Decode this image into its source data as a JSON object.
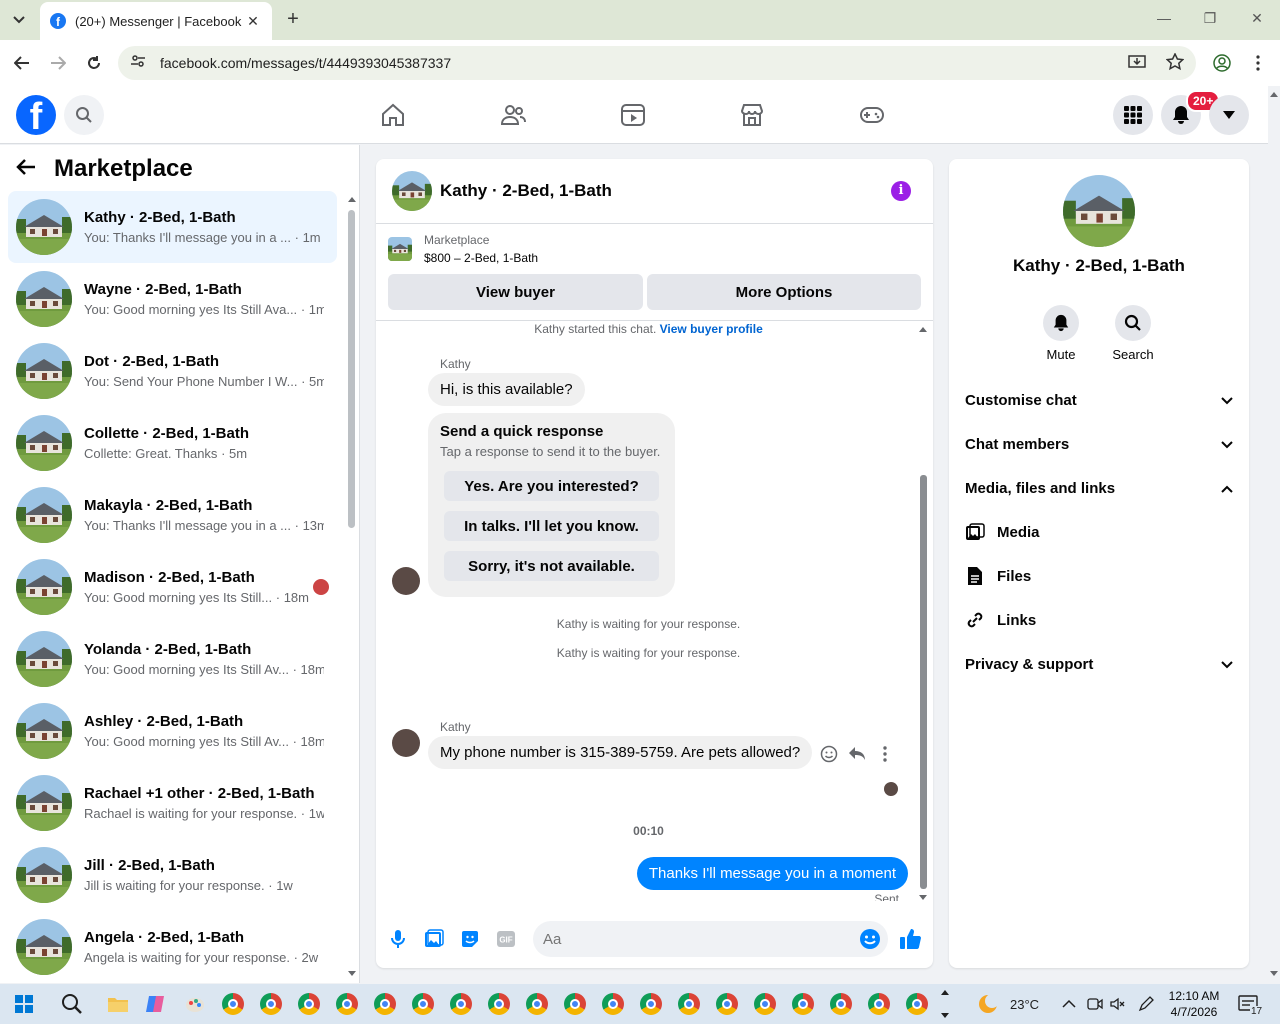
{
  "browser": {
    "tab_title": "(20+) Messenger | Facebook",
    "url": "facebook.com/messages/t/4449393045387337"
  },
  "header": {
    "notification_count": "20+"
  },
  "sidebar": {
    "title": "Marketplace",
    "conversations": [
      {
        "name": "Kathy · 2-Bed, 1-Bath",
        "preview": "You: Thanks I'll message you in a ...",
        "time": "· 1m"
      },
      {
        "name": "Wayne · 2-Bed, 1-Bath",
        "preview": "You: Good morning yes Its Still Ava...",
        "time": "· 1m"
      },
      {
        "name": "Dot · 2-Bed, 1-Bath",
        "preview": "You: Send Your Phone Number I W...",
        "time": "· 5m"
      },
      {
        "name": "Collette · 2-Bed, 1-Bath",
        "preview": "Collette: Great. Thanks",
        "time": "· 5m"
      },
      {
        "name": "Makayla · 2-Bed, 1-Bath",
        "preview": "You: Thanks I'll message you in a ...",
        "time": "· 13m"
      },
      {
        "name": "Madison · 2-Bed, 1-Bath",
        "preview": "You: Good morning yes Its Still...",
        "time": "· 18m"
      },
      {
        "name": "Yolanda · 2-Bed, 1-Bath",
        "preview": "You: Good morning yes Its Still Av...",
        "time": "· 18m"
      },
      {
        "name": "Ashley · 2-Bed, 1-Bath",
        "preview": "You: Good morning yes Its Still Av...",
        "time": "· 18m"
      },
      {
        "name": "Rachael +1 other · 2-Bed, 1-Bath",
        "preview": "Rachael is waiting for your response.",
        "time": "· 1w"
      },
      {
        "name": "Jill · 2-Bed, 1-Bath",
        "preview": "Jill is waiting for your response.",
        "time": "· 1w"
      },
      {
        "name": "Angela · 2-Bed, 1-Bath",
        "preview": "Angela is waiting for your response.",
        "time": "· 2w"
      }
    ]
  },
  "chat": {
    "title": "Kathy · 2-Bed, 1-Bath",
    "marketplace_label": "Marketplace",
    "listing": "$800 – 2-Bed, 1-Bath",
    "view_buyer": "View buyer",
    "more_options": "More Options",
    "started_text": "Kathy started this chat.",
    "view_buyer_profile": "View buyer profile",
    "sender1": "Kathy",
    "msg1": "Hi, is this available?",
    "quick_title": "Send a quick response",
    "quick_sub": "Tap a response to send it to the buyer.",
    "quick_responses": [
      "Yes. Are you interested?",
      "In talks. I'll let you know.",
      "Sorry, it's not available."
    ],
    "waiting1": "Kathy is waiting for your response.",
    "waiting2": "Kathy is waiting for your response.",
    "sender2": "Kathy",
    "msg2": "My phone number is 315-389-5759. Are pets allowed?",
    "timestamp": "00:10",
    "outgoing": "Thanks I'll message you in a moment",
    "sent_status": "Sent",
    "input_placeholder": "Aa"
  },
  "right_panel": {
    "name": "Kathy · 2-Bed, 1-Bath",
    "mute": "Mute",
    "search": "Search",
    "customise": "Customise chat",
    "members": "Chat members",
    "media_section": "Media, files and links",
    "media": "Media",
    "files": "Files",
    "links": "Links",
    "privacy": "Privacy & support"
  },
  "taskbar": {
    "temperature": "23°C",
    "time": "12:10 AM",
    "date": "4/7/2026",
    "notif_count": "17"
  },
  "colors": {
    "accent_blue": "#0084ff",
    "fb_blue": "#0866ff",
    "info_purple": "#9b1fe6"
  }
}
